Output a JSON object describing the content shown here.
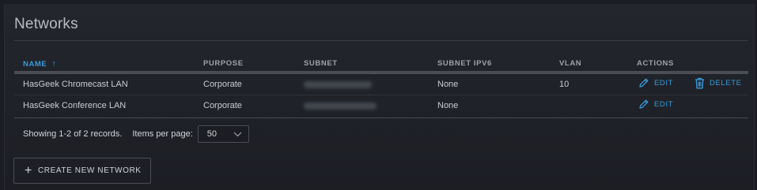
{
  "page": {
    "title": "Networks"
  },
  "table": {
    "columns": {
      "name": "NAME",
      "purpose": "PURPOSE",
      "subnet": "SUBNET",
      "subnet_ipv6": "SUBNET IPV6",
      "vlan": "VLAN",
      "actions": "ACTIONS"
    },
    "sort_arrow": "↑",
    "rows": [
      {
        "name": "HasGeek Chromecast LAN",
        "purpose": "Corporate",
        "subnet_ipv6": "None",
        "vlan": "10",
        "edit": "EDIT",
        "delete": "DELETE"
      },
      {
        "name": "HasGeek Conference LAN",
        "purpose": "Corporate",
        "subnet_ipv6": "None",
        "vlan": "",
        "edit": "EDIT"
      }
    ]
  },
  "footer": {
    "showing": "Showing 1-2 of 2 records.",
    "items_per_page_label": "Items per page:",
    "items_per_page_value": "50"
  },
  "create_button": {
    "label": "CREATE NEW NETWORK"
  },
  "colors": {
    "accent": "#3a9bd9",
    "background": "#1b1d23",
    "text": "#c9ccd0"
  },
  "icons": [
    "pencil-icon",
    "trash-icon",
    "chevron-down-icon",
    "plus-icon",
    "sort-up-arrow-icon"
  ]
}
